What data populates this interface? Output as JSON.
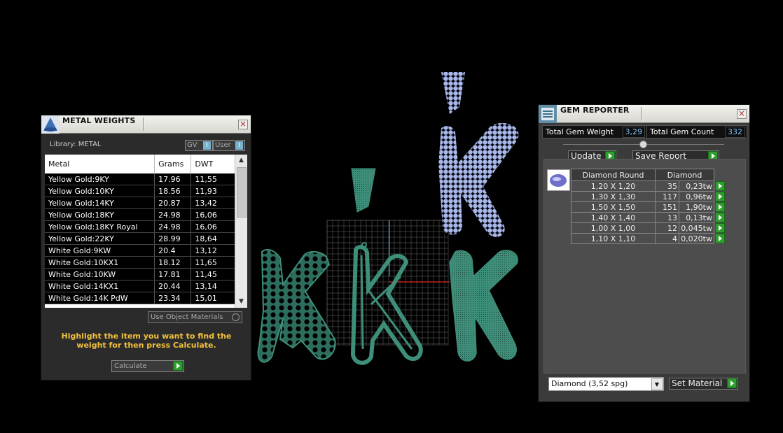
{
  "metal_panel": {
    "title": "METAL WEIGHTS",
    "library_label": "Library: METAL",
    "toggle_gv": "GV",
    "toggle_user": "User",
    "toggle_knob": "I",
    "columns": [
      "Metal",
      "Grams",
      "DWT"
    ],
    "rows": [
      [
        "Yellow Gold:9KY",
        "17.96",
        "11,55"
      ],
      [
        "Yellow Gold:10KY",
        "18.56",
        "11,93"
      ],
      [
        "Yellow Gold:14KY",
        "20.87",
        "13,42"
      ],
      [
        "Yellow Gold:18KY",
        "24.98",
        "16,06"
      ],
      [
        "Yellow Gold:18KY Royal",
        "24.98",
        "16,06"
      ],
      [
        "Yellow Gold:22KY",
        "28.99",
        "18,64"
      ],
      [
        "White Gold:9KW",
        "20.4",
        "13,12"
      ],
      [
        "White Gold:10KX1",
        "18.12",
        "11,65"
      ],
      [
        "White Gold:10KW",
        "17.81",
        "11,45"
      ],
      [
        "White Gold:14KX1",
        "20.44",
        "13,14"
      ],
      [
        "White Gold:14K PdW",
        "23.34",
        "15,01"
      ]
    ],
    "use_object_materials": "Use Object Materials",
    "hint": "Highlight the item you want to find the weight for then press Calculate.",
    "calculate": "Calculate"
  },
  "gem_panel": {
    "title": "GEM REPORTER",
    "total_weight_label": "Total Gem Weight",
    "total_weight_value": "3,29",
    "total_count_label": "Total Gem Count",
    "total_count_value": "332",
    "update": "Update",
    "save_report": "Save Report",
    "header_shape": "Diamond Round",
    "header_material": "Diamond",
    "rows": [
      [
        "1,20 X 1,20",
        "35",
        "0,23tw"
      ],
      [
        "1,30 X 1,30",
        "117",
        "0,96tw"
      ],
      [
        "1,50 X 1,50",
        "151",
        "1,90tw"
      ],
      [
        "1,40 X 1,40",
        "13",
        "0,13tw"
      ],
      [
        "1,00 X 1,00",
        "12",
        "0,045tw"
      ],
      [
        "1,10 X 1,10",
        "4",
        "0,020tw"
      ]
    ],
    "material_select": "Diamond     (3,52 spg)",
    "set_material": "Set Material"
  },
  "close_glyph": "×",
  "colors": {
    "mesh": "#3e8f7a",
    "gems": "#a9b8e6",
    "hint": "#f2c13a",
    "play": "#2e9e2e"
  }
}
